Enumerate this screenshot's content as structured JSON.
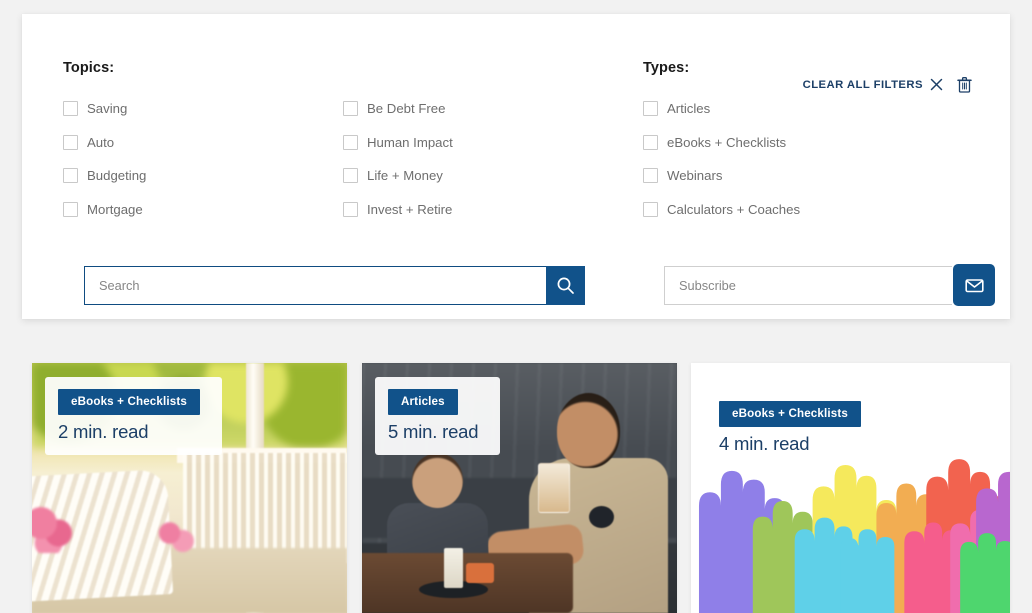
{
  "filters": {
    "topics": {
      "heading": "Topics:",
      "items": [
        {
          "label": "Saving",
          "checked": false
        },
        {
          "label": "Be Debt Free",
          "checked": false
        },
        {
          "label": "Auto",
          "checked": false
        },
        {
          "label": "Human Impact",
          "checked": false
        },
        {
          "label": "Budgeting",
          "checked": false
        },
        {
          "label": "Life + Money",
          "checked": false
        },
        {
          "label": "Mortgage",
          "checked": false
        },
        {
          "label": "Invest + Retire",
          "checked": false
        }
      ]
    },
    "types": {
      "heading": "Types:",
      "items": [
        {
          "label": "Articles",
          "checked": false
        },
        {
          "label": "eBooks + Checklists",
          "checked": false
        },
        {
          "label": "Webinars",
          "checked": false
        },
        {
          "label": "Calculators + Coaches",
          "checked": false
        }
      ]
    },
    "clear_all": {
      "label": "CLEAR ALL FILTERS",
      "close_icon": "close-x-icon",
      "trash_icon": "trash-can-icon"
    }
  },
  "search": {
    "placeholder": "Search",
    "value": "",
    "button_icon": "search-magnifier-icon"
  },
  "subscribe": {
    "placeholder": "Subscribe",
    "value": "",
    "button_icon": "envelope-icon"
  },
  "cards": [
    {
      "badge": "eBooks + Checklists",
      "read_time": "2 min. read",
      "image_alt": "white porch bench with flowers"
    },
    {
      "badge": "Articles",
      "read_time": "5 min. read",
      "image_alt": "man and child at cafe table"
    },
    {
      "badge": "eBooks + Checklists",
      "read_time": "4 min. read",
      "image_alt": "colorful raised hands illustration"
    }
  ],
  "colors": {
    "accent_blue": "#11528a",
    "navy_text": "#1c3f67",
    "page_background": "#f2f2f2",
    "panel_background": "#ffffff",
    "checkbox_border": "#c9c9c9",
    "label_gray": "#6e6e6e"
  }
}
